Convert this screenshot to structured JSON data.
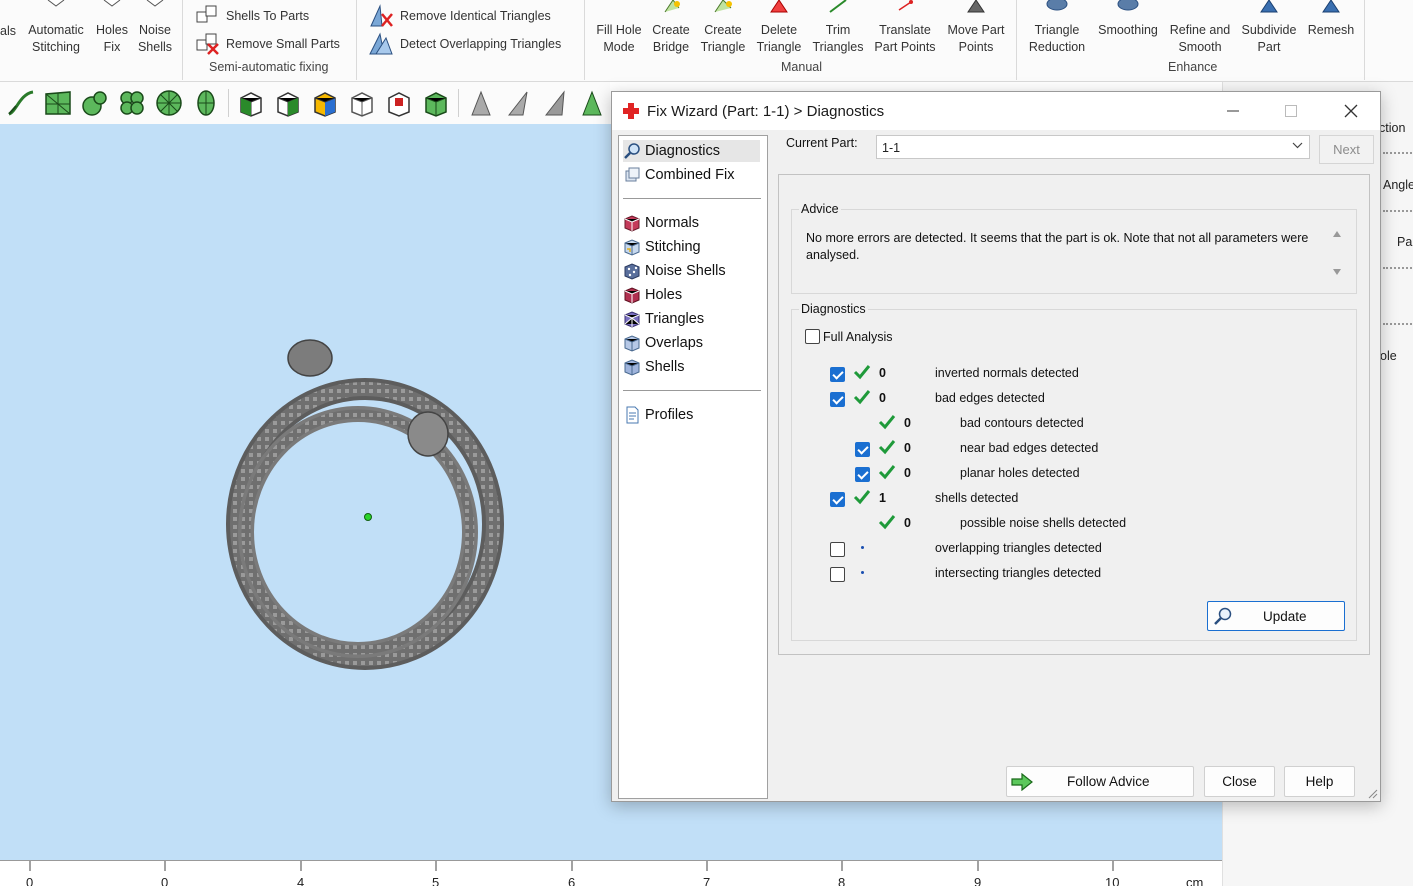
{
  "ribbon": {
    "semi_auto": {
      "group_label": "Semi-automatic fixing",
      "buttons": [
        {
          "label": "als"
        },
        {
          "label": "Automatic\nStitching"
        },
        {
          "label": "Holes\nFix"
        },
        {
          "label": "Noise\nShells"
        }
      ],
      "small_items": [
        "Shells To Parts",
        "Remove Small Parts"
      ]
    },
    "triangles_group": {
      "small_items": [
        "Remove Identical Triangles",
        "Detect Overlapping Triangles"
      ]
    },
    "manual": {
      "group_label": "Manual",
      "buttons": [
        {
          "label": "Fill Hole\nMode"
        },
        {
          "label": "Create\nBridge"
        },
        {
          "label": "Create\nTriangle"
        },
        {
          "label": "Delete\nTriangle"
        },
        {
          "label": "Trim\nTriangles"
        },
        {
          "label": "Translate\nPart Points"
        },
        {
          "label": "Move Part\nPoints"
        }
      ]
    },
    "enhance": {
      "group_label": "Enhance",
      "buttons": [
        {
          "label": "Triangle\nReduction"
        },
        {
          "label": "Smoothing"
        },
        {
          "label": "Refine and\nSmooth"
        },
        {
          "label": "Subdivide\nPart"
        },
        {
          "label": "Remesh"
        }
      ]
    }
  },
  "ruler": {
    "ticks": [
      "0",
      "0",
      "4",
      "5",
      "6",
      "7",
      "8",
      "9",
      "10",
      "cm"
    ]
  },
  "right_panel": {
    "fragments": [
      "ction",
      "Angle",
      "Par",
      "ole"
    ]
  },
  "dialog": {
    "title": "Fix Wizard (Part: 1-1) > Diagnostics",
    "nav": {
      "top": [
        {
          "label": "Diagnostics",
          "icon": "magnifier-icon",
          "selected": true
        },
        {
          "label": "Combined Fix",
          "icon": "cube-stack-icon",
          "selected": false
        }
      ],
      "middle": [
        {
          "label": "Normals",
          "icon": "normals-cube-icon"
        },
        {
          "label": "Stitching",
          "icon": "stitching-cube-icon"
        },
        {
          "label": "Noise Shells",
          "icon": "noise-shells-icon"
        },
        {
          "label": "Holes",
          "icon": "holes-cube-icon"
        },
        {
          "label": "Triangles",
          "icon": "triangles-cube-icon"
        },
        {
          "label": "Overlaps",
          "icon": "overlaps-cube-icon"
        },
        {
          "label": "Shells",
          "icon": "shells-cube-icon"
        }
      ],
      "bottom": [
        {
          "label": "Profiles",
          "icon": "document-icon"
        }
      ]
    },
    "current_part_label": "Current Part:",
    "current_part_value": "1-1",
    "next_label": "Next",
    "advice": {
      "legend": "Advice",
      "text": "No more errors are detected. It seems that the part is ok. Note that not all parameters were analysed."
    },
    "diagnostics": {
      "legend": "Diagnostics",
      "full_analysis_label": "Full Analysis",
      "full_analysis_checked": false,
      "rows": [
        {
          "indent": 0,
          "has_checkbox": true,
          "checked": true,
          "status": "ok",
          "count": "0",
          "label": "inverted normals detected"
        },
        {
          "indent": 0,
          "has_checkbox": true,
          "checked": true,
          "status": "ok",
          "count": "0",
          "label": "bad edges detected"
        },
        {
          "indent": 1,
          "has_checkbox": false,
          "checked": false,
          "status": "ok",
          "count": "0",
          "label": "bad contours detected"
        },
        {
          "indent": 1,
          "has_checkbox": true,
          "checked": true,
          "status": "ok",
          "count": "0",
          "label": "near bad edges detected"
        },
        {
          "indent": 1,
          "has_checkbox": true,
          "checked": true,
          "status": "ok",
          "count": "0",
          "label": "planar holes detected"
        },
        {
          "indent": 0,
          "has_checkbox": true,
          "checked": true,
          "status": "ok",
          "count": "1",
          "label": "shells detected"
        },
        {
          "indent": 1,
          "has_checkbox": false,
          "checked": false,
          "status": "ok",
          "count": "0",
          "label": "possible noise shells detected"
        },
        {
          "indent": 0,
          "has_checkbox": true,
          "checked": false,
          "status": "none",
          "count": "",
          "label": "overlapping triangles detected"
        },
        {
          "indent": 0,
          "has_checkbox": true,
          "checked": false,
          "status": "none",
          "count": "",
          "label": "intersecting triangles detected"
        }
      ],
      "update_label": "Update"
    },
    "buttons": {
      "follow_advice": "Follow Advice",
      "close": "Close",
      "help": "Help"
    }
  },
  "colors": {
    "viewport_bg": "#c1dff7",
    "accent": "#1a6fd1",
    "check_green": "#1f9a3a",
    "title_icon_red": "#e02424"
  }
}
